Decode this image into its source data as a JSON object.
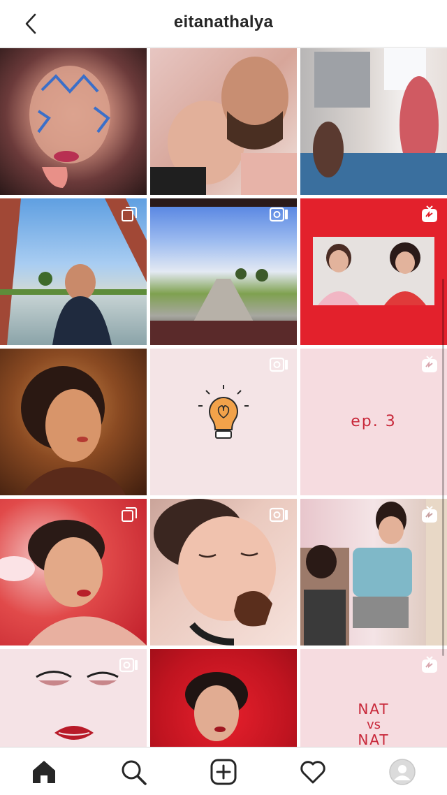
{
  "header": {
    "username": "eitanathalya",
    "back_icon": "chevron-left-icon"
  },
  "grid": {
    "tiles": [
      {
        "row": 1,
        "col": 1,
        "subject": "face-blue-paint",
        "badge": "none"
      },
      {
        "row": 1,
        "col": 2,
        "subject": "couple-selfie",
        "badge": "none"
      },
      {
        "row": 1,
        "col": 3,
        "subject": "bedroom-pink-dress",
        "badge": "none"
      },
      {
        "row": 2,
        "col": 1,
        "subject": "woman-by-river",
        "badge": "carousel-icon"
      },
      {
        "row": 2,
        "col": 2,
        "subject": "road-through-windshield",
        "badge": "video-icon"
      },
      {
        "row": 2,
        "col": 3,
        "subject": "two-women-red-frame",
        "badge": "igtv-icon"
      },
      {
        "row": 3,
        "col": 1,
        "subject": "portrait-warm-light",
        "badge": "none"
      },
      {
        "row": 3,
        "col": 2,
        "subject": "lightbulb-heart-drawing",
        "badge": "video-icon"
      },
      {
        "row": 3,
        "col": 3,
        "subject": "ep3-pink-card",
        "text": "ep. 3",
        "badge": "igtv-icon"
      },
      {
        "row": 4,
        "col": 1,
        "subject": "woman-red-clouds",
        "badge": "carousel-icon"
      },
      {
        "row": 4,
        "col": 2,
        "subject": "woman-eating-cookie",
        "badge": "video-icon"
      },
      {
        "row": 4,
        "col": 3,
        "subject": "mirror-two-women",
        "badge": "igtv-icon"
      },
      {
        "row": 5,
        "col": 1,
        "subject": "illustrated-face-lips",
        "badge": "video-icon"
      },
      {
        "row": 5,
        "col": 2,
        "subject": "woman-red-fabric",
        "badge": "none"
      },
      {
        "row": 5,
        "col": 3,
        "subject": "nat-vs-nat-card",
        "text_lines": [
          "NAT",
          "vs",
          "NAT"
        ],
        "badge": "igtv-icon"
      }
    ]
  },
  "bottom_nav": {
    "items": [
      {
        "name": "home",
        "icon": "home-icon",
        "active": true
      },
      {
        "name": "search",
        "icon": "search-icon",
        "active": false
      },
      {
        "name": "new-post",
        "icon": "plus-square-icon",
        "active": false
      },
      {
        "name": "activity",
        "icon": "heart-icon",
        "active": false
      },
      {
        "name": "profile",
        "icon": "avatar-icon",
        "active": false
      }
    ]
  },
  "colors": {
    "text_primary": "#262626",
    "divider": "#dbdbdb",
    "brand_red": "#e3212c",
    "card_pink": "#f6dce0"
  }
}
